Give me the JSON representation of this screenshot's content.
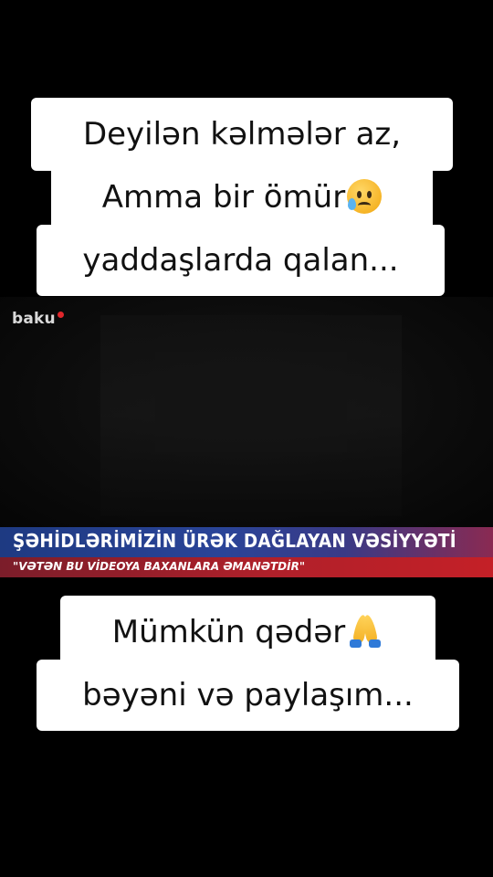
{
  "video": {
    "logo_text": "baku",
    "ticker_title": "ŞƏHİDLƏRİMİZİN ÜRƏK DAĞLAYAN VƏSİYYƏTİ",
    "ticker_subtitle": "\"VƏTƏN BU VİDEOYA BAXANLARA ƏMANƏTDİR\""
  },
  "top_caption": {
    "line1": "Deyilən kəlmələr az,",
    "line2": "Amma bir ömür",
    "line2_emoji": "sad-relieved-face-icon",
    "line3": "yaddaşlarda qalan..."
  },
  "bottom_caption": {
    "line1": "Mümkün qədər",
    "line1_emoji": "folded-hands-icon",
    "line2": "bəyəni və paylaşım..."
  },
  "colors": {
    "background": "#000000",
    "caption_bg": "#ffffff",
    "ticker_blue": "#2a4498",
    "ticker_red": "#c42027",
    "logo_red": "#e0262b"
  }
}
